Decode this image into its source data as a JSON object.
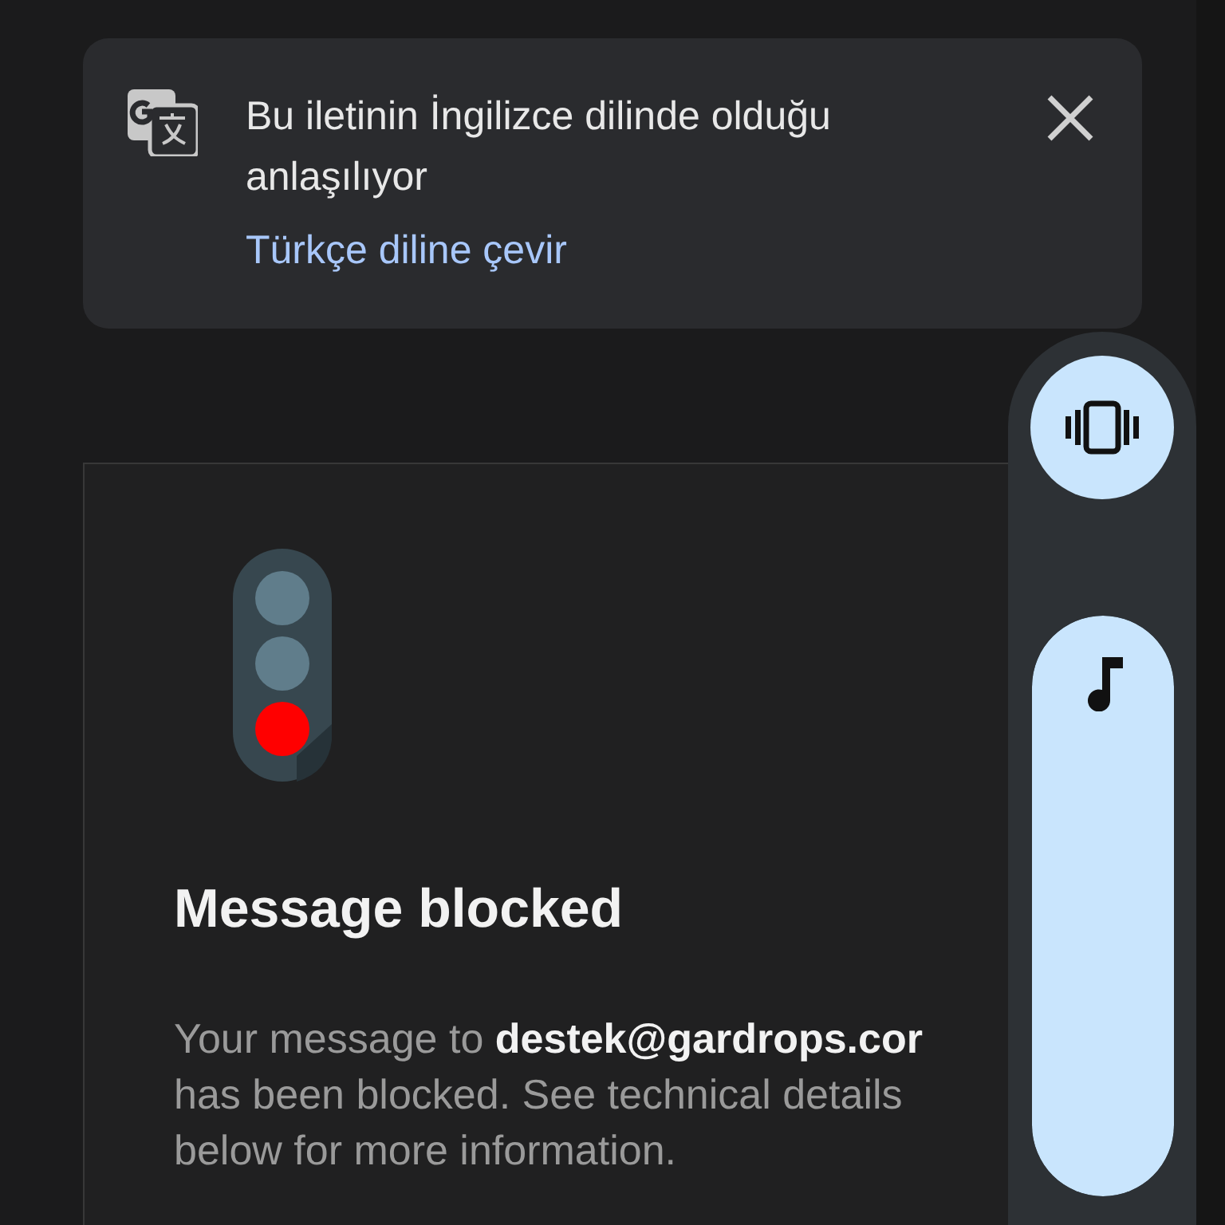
{
  "translate_banner": {
    "message": "Bu iletinin İngilizce dilinde olduğu anlaşılıyor",
    "action": "Türkçe diline çevir"
  },
  "message_card": {
    "title": "Message blocked",
    "body_lines": [
      "Your message to **destek@gardrops.cor**",
      "has been blocked. See technical details",
      "below for more information."
    ]
  },
  "volume_panel": {
    "ringer_button": {
      "kind": "vibrate"
    },
    "media_slider": {
      "level": 1
    }
  }
}
